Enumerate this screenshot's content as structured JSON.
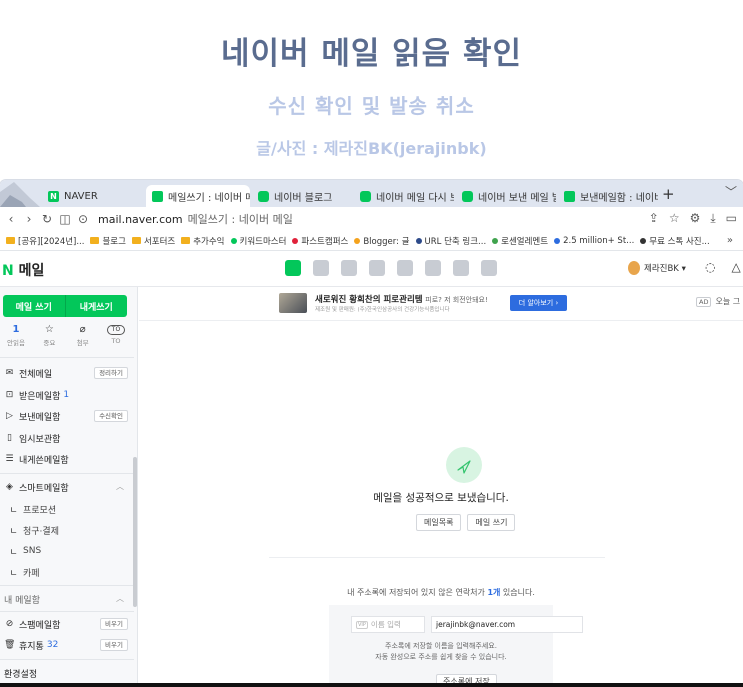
{
  "banner": {
    "title": "네이버 메일 읽음 확인",
    "subtitle": "수신 확인 및 발송 취소",
    "credit": "글/사진 : 제라진BK(jerajinbk)"
  },
  "browser": {
    "tabs": [
      {
        "label": "NAVER",
        "favicon": "naver-n-icon",
        "active": false
      },
      {
        "label": "메일쓰기 : 네이버 메일",
        "favicon": "mail-icon",
        "active": true
      },
      {
        "label": "네이버 블로그",
        "favicon": "blog-icon",
        "active": false
      },
      {
        "label": "네이버 메일 다시 보내",
        "favicon": "blog-icon",
        "active": false
      },
      {
        "label": "네이버 보낸 메일 발송",
        "favicon": "blog-icon",
        "active": false
      },
      {
        "label": "보낸메일함 : 네이버 미",
        "favicon": "mail-icon",
        "active": false
      }
    ],
    "new_tab": "+",
    "tab_menu": "﹀",
    "address": {
      "host": "mail.naver.com",
      "page_title": "메일쓰기 : 네이버 메일"
    },
    "bookmarks": [
      {
        "label": "[공유][2024년]...",
        "kind": "folder"
      },
      {
        "label": "블로그",
        "kind": "folder"
      },
      {
        "label": "서포터즈",
        "kind": "folder"
      },
      {
        "label": "추가수익",
        "kind": "folder"
      },
      {
        "label": "키워드마스터",
        "kind": "site",
        "color": "#03c75a"
      },
      {
        "label": "파스트캠퍼스",
        "kind": "site",
        "color": "#e0213a"
      },
      {
        "label": "Blogger: 글",
        "kind": "site",
        "color": "#f4a21c"
      },
      {
        "label": "URL 단축 링크...",
        "kind": "site",
        "color": "#2d4a8a"
      },
      {
        "label": "로센얼레멘트",
        "kind": "site",
        "color": "#3fa34d"
      },
      {
        "label": "2.5 million+ St...",
        "kind": "site",
        "color": "#2d6cdf"
      },
      {
        "label": "무료 스톡 사진...",
        "kind": "site",
        "color": "#333333"
      }
    ],
    "bookmarks_more": "»"
  },
  "mail": {
    "logo_n": "N",
    "logo_text": "메일",
    "profile_name": "제라진BK ▾",
    "sidebar": {
      "write_mail": "메일 쓰기",
      "write_to_me": "내게쓰기",
      "quick": [
        {
          "top": "1",
          "label": "안읽음",
          "is_count": true
        },
        {
          "top": "☆",
          "label": "중요",
          "is_count": false
        },
        {
          "top": "⌀",
          "label": "첨부",
          "is_count": false
        },
        {
          "top": "TO",
          "label": "TO",
          "is_count": false
        }
      ],
      "all_mail": "전체메일",
      "all_mail_chip": "정리하기",
      "inbox": "받은메일함",
      "inbox_count": "1",
      "sent": "보낸메일함",
      "sent_chip": "수신확인",
      "drafts": "임시보관함",
      "to_me": "내게쓴메일함",
      "smart": "스마트메일함",
      "smart_subs": [
        "프로모션",
        "청구·결제",
        "SNS",
        "카페"
      ],
      "my_folders": "내 메일함",
      "spam": "스팸메일함",
      "spam_chip": "비우기",
      "trash": "휴지통",
      "trash_count": "32",
      "trash_chip": "비우기",
      "settings": "환경설정"
    },
    "ad": {
      "title_bold": "새로워진 황희찬의 피로관리템",
      "title_rest": "피로? 저 회전안돼요!",
      "subtitle": "제조원 및 판매원: (주)한국인삼공사의 건강기능식품입니다",
      "cta": "더 알아보기 ›",
      "badge": "AD",
      "right_text": "오늘 그"
    },
    "sent_message": "메일을 성공적으로 보냈습니다.",
    "mail_list_button": "메일목록",
    "write_button": "메일 쓰기",
    "notice_prefix": "내 주소록에 저장되어 있지 않은 연락처가 ",
    "notice_count": "1개",
    "notice_suffix": " 있습니다.",
    "contact": {
      "vip": "VIP",
      "name_placeholder": "이름 입력",
      "email": "jerajinbk@naver.com",
      "help_line1": "주소록에 저장할 이름을 입력해주세요.",
      "help_line2": "자동 완성으로 주소를 쉽게 찾을 수 있습니다.",
      "save": "주소록에 저장"
    }
  },
  "colors": {
    "naver_green": "#03c75a",
    "banner_title": "#5a6c8f",
    "banner_sub": "#b9c7e6",
    "link_blue": "#2d6cdf"
  }
}
